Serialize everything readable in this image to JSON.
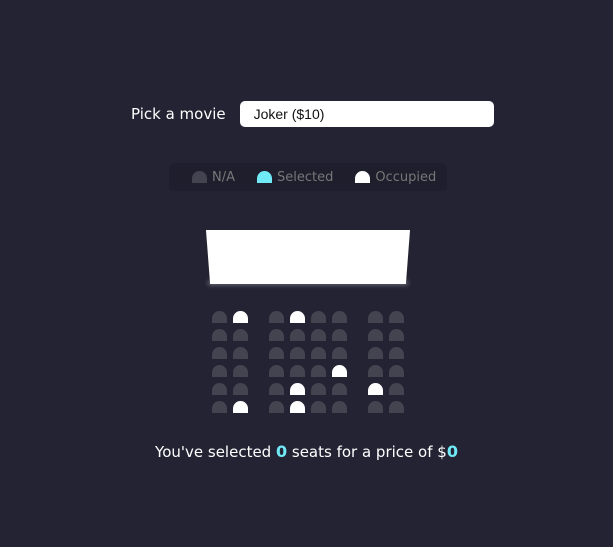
{
  "picker": {
    "label": "Pick a movie",
    "selected_value": "Joker ($10)"
  },
  "legend": [
    {
      "label": "N/A",
      "color": "#444451"
    },
    {
      "label": "Selected",
      "color": "#6feaf6"
    },
    {
      "label": "Occupied",
      "color": "#ffffff"
    }
  ],
  "colors": {
    "background": "#242333",
    "seat_available": "#444451",
    "seat_selected": "#6feaf6",
    "seat_occupied": "#ffffff",
    "count_highlight": "#6feaf6"
  },
  "seats": {
    "rows": [
      [
        "available",
        "occupied",
        "available",
        "occupied",
        "available",
        "available",
        "available",
        "available"
      ],
      [
        "available",
        "available",
        "available",
        "available",
        "available",
        "available",
        "available",
        "available"
      ],
      [
        "available",
        "available",
        "available",
        "available",
        "available",
        "available",
        "available",
        "available"
      ],
      [
        "available",
        "available",
        "available",
        "available",
        "available",
        "occupied",
        "available",
        "available"
      ],
      [
        "available",
        "available",
        "available",
        "occupied",
        "available",
        "available",
        "occupied",
        "available"
      ],
      [
        "available",
        "occupied",
        "available",
        "occupied",
        "available",
        "available",
        "available",
        "available"
      ]
    ]
  },
  "summary": {
    "prefix": "You've selected ",
    "count": "0",
    "middle": " seats for a price of $",
    "price": "0"
  }
}
